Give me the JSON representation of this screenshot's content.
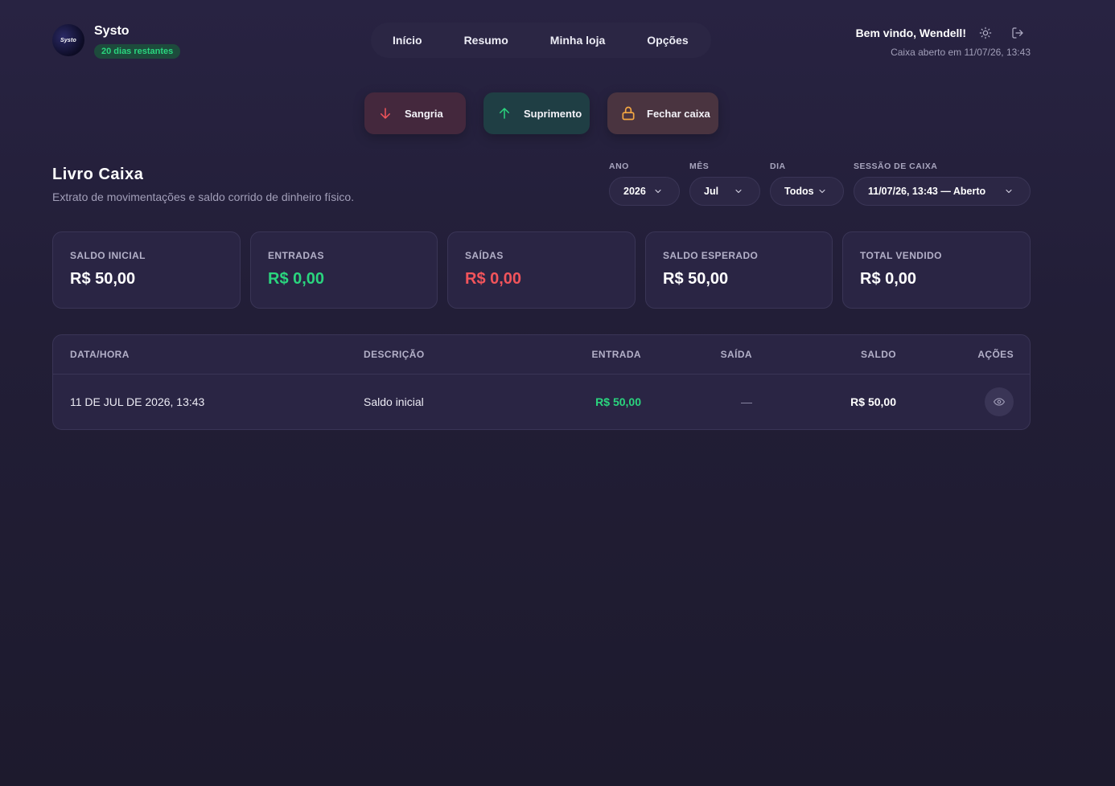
{
  "brand": {
    "logo_text": "Systo",
    "name": "Systo",
    "trial_badge": "20 dias restantes"
  },
  "nav": {
    "items": [
      {
        "label": "Início"
      },
      {
        "label": "Resumo"
      },
      {
        "label": "Minha loja"
      },
      {
        "label": "Opções"
      }
    ]
  },
  "user": {
    "welcome": "Bem vindo, Wendell!",
    "caixa_status": "Caixa aberto em 11/07/26, 13:43"
  },
  "actions": {
    "sangria": "Sangria",
    "suprimento": "Suprimento",
    "fechar": "Fechar caixa"
  },
  "page": {
    "title": "Livro Caixa",
    "subtitle": "Extrato de movimentações e saldo corrido de dinheiro físico."
  },
  "filters": {
    "ano": {
      "label": "ANO",
      "value": "2026"
    },
    "mes": {
      "label": "MÊS",
      "value": "Jul"
    },
    "dia": {
      "label": "DIA",
      "value": "Todos"
    },
    "sessao": {
      "label": "SESSÃO DE CAIXA",
      "value": "11/07/26, 13:43 — Aberto"
    }
  },
  "stats": [
    {
      "label": "SALDO INICIAL",
      "value": "R$ 50,00",
      "color": "#ffffff"
    },
    {
      "label": "ENTRADAS",
      "value": "R$ 0,00",
      "color": "#2ad57e"
    },
    {
      "label": "SAÍDAS",
      "value": "R$ 0,00",
      "color": "#f2545b"
    },
    {
      "label": "SALDO ESPERADO",
      "value": "R$ 50,00",
      "color": "#ffffff"
    },
    {
      "label": "TOTAL VENDIDO",
      "value": "R$ 0,00",
      "color": "#ffffff"
    }
  ],
  "table": {
    "headers": {
      "datahora": "DATA/HORA",
      "descricao": "DESCRIÇÃO",
      "entrada": "ENTRADA",
      "saida": "SAÍDA",
      "saldo": "SALDO",
      "acoes": "AÇÕES"
    },
    "rows": [
      {
        "datahora": "11 DE JUL DE 2026, 13:43",
        "descricao": "Saldo inicial",
        "entrada": "R$ 50,00",
        "saida": "—",
        "saldo": "R$ 50,00"
      }
    ]
  },
  "colors": {
    "accent_green": "#2ad57e",
    "accent_red": "#f2545b",
    "accent_orange": "#f5a742"
  },
  "icons": {
    "sun": "sun-icon",
    "logout": "logout-icon",
    "sangria": "arrow-down-icon",
    "suprimento": "arrow-up-icon",
    "fechar": "lock-icon",
    "chevron": "chevron-down-icon",
    "view": "eye-icon"
  }
}
